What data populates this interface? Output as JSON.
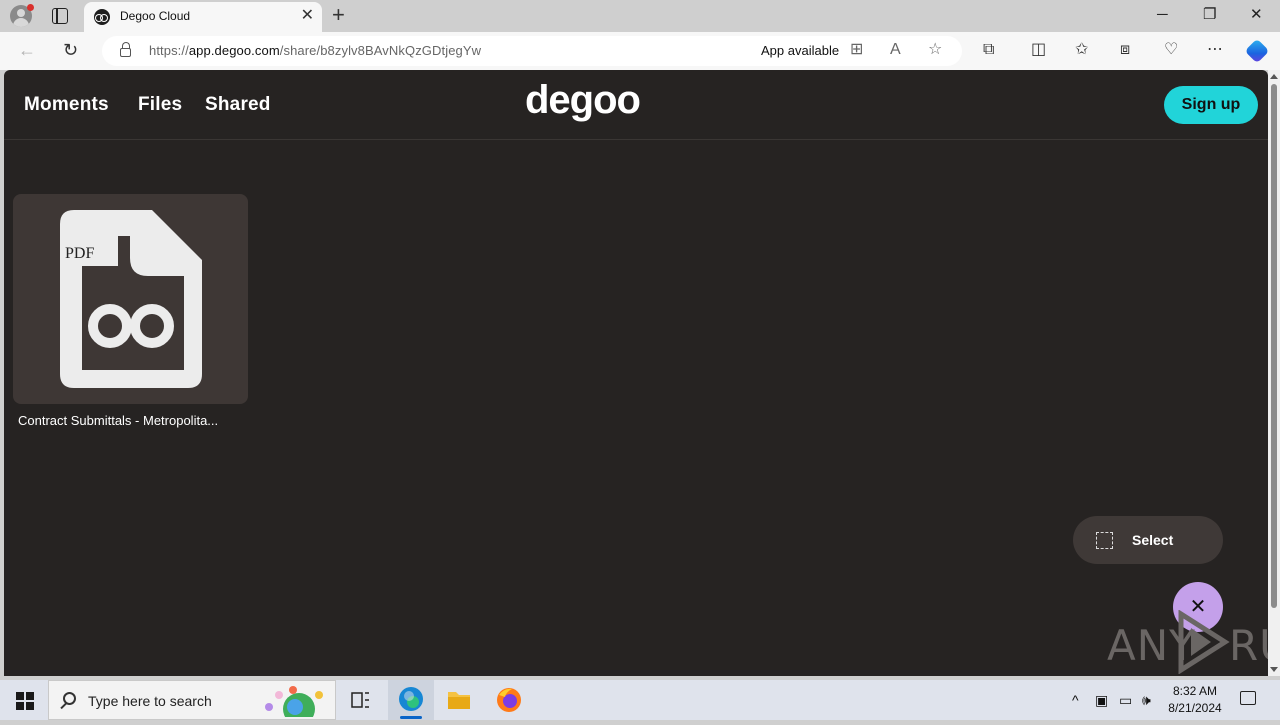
{
  "browser": {
    "tab_title": "Degoo Cloud",
    "tab_close": "✕",
    "new_tab": "+",
    "url_prefix": "https://",
    "url_domain": "app.degoo.com",
    "url_path": "/share/b8zylv8BAvNkQzGDtjegYw",
    "app_available": "App available",
    "window_controls": {
      "minimize": "─",
      "restore": "❐",
      "close": "✕"
    }
  },
  "site": {
    "nav": [
      {
        "label": "Moments"
      },
      {
        "label": "Files"
      },
      {
        "label": "Shared"
      }
    ],
    "logo": "degoo",
    "signup_label": "Sign up"
  },
  "files": [
    {
      "name": "Contract Submittals - Metropolita...",
      "type_label": "PDF"
    }
  ],
  "actions": {
    "select_label": "Select",
    "close_symbol": "✕"
  },
  "watermark": {
    "left": "ANY",
    "right": "RUN"
  },
  "taskbar": {
    "search_placeholder": "Type here to search",
    "time": "8:32 AM",
    "date": "8/21/2024"
  },
  "colors": {
    "page_bg": "#262322",
    "card_bg": "#3e3735",
    "signup_bg": "#21d4d9",
    "close_fab_bg": "#c4a0ea"
  }
}
